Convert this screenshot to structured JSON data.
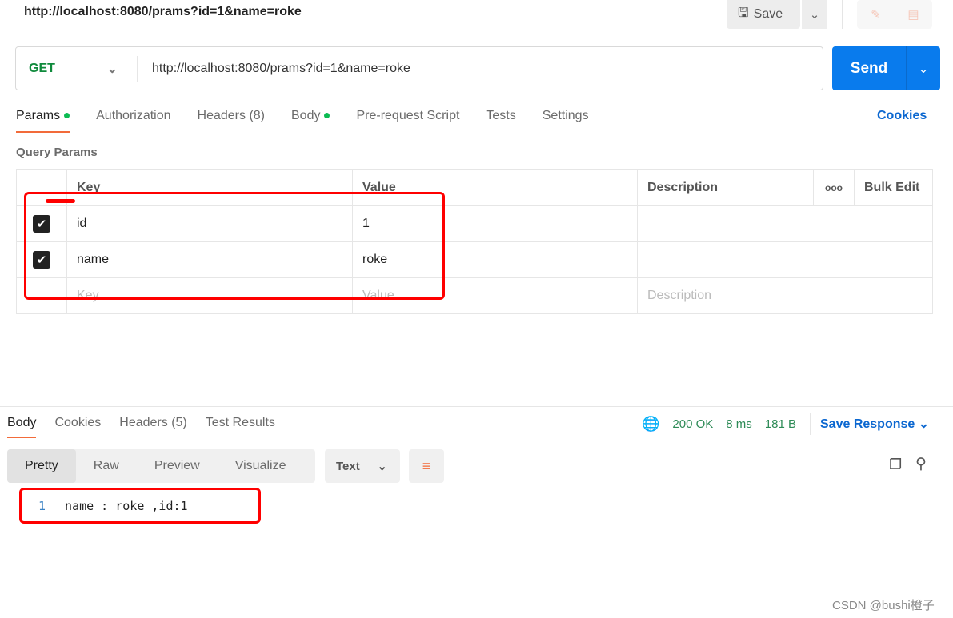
{
  "request": {
    "title": "http://localhost:8080/prams?id=1&name=roke",
    "save_label": "Save",
    "method": "GET",
    "url": "http://localhost:8080/prams?id=1&name=roke",
    "send_label": "Send"
  },
  "tabs": [
    {
      "label": "Params",
      "dot": true
    },
    {
      "label": "Authorization"
    },
    {
      "label": "Headers (8)"
    },
    {
      "label": "Body",
      "dot": true
    },
    {
      "label": "Pre-request Script"
    },
    {
      "label": "Tests"
    },
    {
      "label": "Settings"
    }
  ],
  "cookies_label": "Cookies",
  "query_params": {
    "title": "Query Params",
    "headers": {
      "key": "Key",
      "value": "Value",
      "description": "Description",
      "more": "ooo",
      "bulk": "Bulk Edit"
    },
    "rows": [
      {
        "key": "id",
        "value": "1",
        "checked": true
      },
      {
        "key": "name",
        "value": "roke",
        "checked": true
      }
    ],
    "placeholder": {
      "key": "Key",
      "value": "Value",
      "description": "Description"
    }
  },
  "response": {
    "tabs": [
      "Body",
      "Cookies",
      "Headers (5)",
      "Test Results"
    ],
    "status": "200 OK",
    "time": "8 ms",
    "size": "181 B",
    "save_label": "Save Response",
    "views": [
      "Pretty",
      "Raw",
      "Preview",
      "Visualize"
    ],
    "format": "Text",
    "lines": [
      {
        "n": "1",
        "text": "name : roke ,id:1"
      }
    ]
  },
  "watermark": "CSDN @bushi橙子"
}
